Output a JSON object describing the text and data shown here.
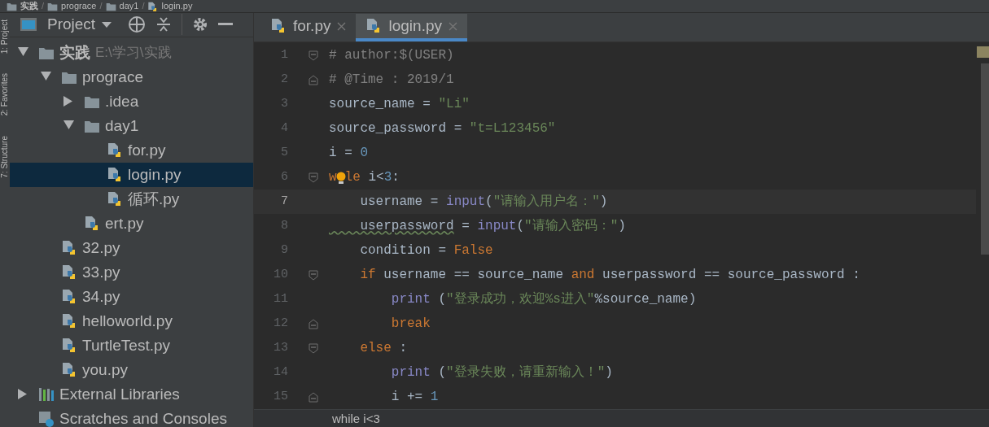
{
  "breadcrumb": {
    "separator": "/",
    "items": [
      "实践",
      "prograce",
      "day1",
      "login.py"
    ]
  },
  "side_strip": [
    "1: Project",
    "2: Favorites",
    "7: Structure"
  ],
  "project_panel": {
    "title": "Project"
  },
  "tree": [
    {
      "kind": "folder",
      "label": "实践",
      "path": "E:\\学习\\实践",
      "expanded": true,
      "selected": false,
      "children": [
        {
          "kind": "folder",
          "label": "prograce",
          "expanded": true,
          "selected": false,
          "children": [
            {
              "kind": "folder",
              "label": ".idea",
              "expanded": false,
              "selected": false
            },
            {
              "kind": "folder",
              "label": "day1",
              "expanded": true,
              "selected": false,
              "children": [
                {
                  "kind": "file",
                  "label": "for.py",
                  "selected": false
                },
                {
                  "kind": "file",
                  "label": "login.py",
                  "selected": true
                },
                {
                  "kind": "file",
                  "label": "循环.py",
                  "selected": false
                }
              ]
            },
            {
              "kind": "file",
              "label": "ert.py",
              "selected": false
            }
          ]
        },
        {
          "kind": "file",
          "label": "32.py",
          "selected": false
        },
        {
          "kind": "file",
          "label": "33.py",
          "selected": false
        },
        {
          "kind": "file",
          "label": "34.py",
          "selected": false
        },
        {
          "kind": "file",
          "label": "helloworld.py",
          "selected": false
        },
        {
          "kind": "file",
          "label": "TurtleTest.py",
          "selected": false
        },
        {
          "kind": "file",
          "label": "you.py",
          "selected": false
        }
      ]
    },
    {
      "kind": "library",
      "label": "External Libraries",
      "expanded": false,
      "selected": false
    },
    {
      "kind": "scratches",
      "label": "Scratches and Consoles",
      "selected": false
    }
  ],
  "tabs": [
    {
      "label": "for.py",
      "selected": false
    },
    {
      "label": "login.py",
      "selected": true
    }
  ],
  "code": [
    {
      "n": "1",
      "fold_open": true,
      "fold_close": false,
      "current": false,
      "lightbulb": false,
      "tokens": [
        {
          "kind": "comment",
          "t": "# author:$(USER)"
        }
      ]
    },
    {
      "n": "2",
      "fold_open": false,
      "fold_close": true,
      "current": false,
      "lightbulb": false,
      "tokens": [
        {
          "kind": "comment",
          "t": "# @Time : 2019/1"
        }
      ]
    },
    {
      "n": "3",
      "fold_open": false,
      "fold_close": false,
      "current": false,
      "lightbulb": false,
      "tokens": [
        {
          "kind": "plain",
          "t": "source_name = "
        },
        {
          "kind": "string",
          "t": "\"Li\""
        }
      ]
    },
    {
      "n": "4",
      "fold_open": false,
      "fold_close": false,
      "current": false,
      "lightbulb": false,
      "tokens": [
        {
          "kind": "plain",
          "t": "source_password = "
        },
        {
          "kind": "string",
          "t": "\"t=L123456\""
        }
      ]
    },
    {
      "n": "5",
      "fold_open": false,
      "fold_close": false,
      "current": false,
      "lightbulb": false,
      "tokens": [
        {
          "kind": "plain",
          "t": "i = "
        },
        {
          "kind": "number",
          "t": "0"
        }
      ]
    },
    {
      "n": "6",
      "fold_open": true,
      "fold_close": false,
      "current": false,
      "lightbulb": true,
      "tokens": [
        {
          "kind": "keyword",
          "t": "w"
        },
        {
          "kind": "keyword",
          "t": "le"
        },
        {
          "kind": "plain",
          "t": " i<"
        },
        {
          "kind": "number",
          "t": "3"
        },
        {
          "kind": "plain",
          "t": ":"
        }
      ]
    },
    {
      "n": "7",
      "fold_open": false,
      "fold_close": false,
      "current": true,
      "lightbulb": false,
      "tokens": [
        {
          "kind": "plain",
          "t": "    username = "
        },
        {
          "kind": "builtin",
          "t": "input"
        },
        {
          "kind": "plain",
          "t": "("
        },
        {
          "kind": "string",
          "t": "\"请输入用户名：\""
        },
        {
          "kind": "plain",
          "t": ")"
        }
      ]
    },
    {
      "n": "8",
      "fold_open": false,
      "fold_close": false,
      "current": false,
      "lightbulb": false,
      "tokens": [
        {
          "kind": "warning",
          "t": "    userpassword"
        },
        {
          "kind": "plain",
          "t": " = "
        },
        {
          "kind": "builtin",
          "t": "input"
        },
        {
          "kind": "plain",
          "t": "("
        },
        {
          "kind": "string",
          "t": "\"请输入密码：\""
        },
        {
          "kind": "plain",
          "t": ")"
        }
      ]
    },
    {
      "n": "9",
      "fold_open": false,
      "fold_close": false,
      "current": false,
      "lightbulb": false,
      "tokens": [
        {
          "kind": "plain",
          "t": "    condition = "
        },
        {
          "kind": "keyword",
          "t": "False"
        }
      ]
    },
    {
      "n": "10",
      "fold_open": true,
      "fold_close": false,
      "current": false,
      "lightbulb": false,
      "tokens": [
        {
          "kind": "keyword",
          "t": "    if"
        },
        {
          "kind": "plain",
          "t": " username == source_name "
        },
        {
          "kind": "keyword",
          "t": "and"
        },
        {
          "kind": "plain",
          "t": " userpassword == source_password :"
        }
      ]
    },
    {
      "n": "11",
      "fold_open": false,
      "fold_close": false,
      "current": false,
      "lightbulb": false,
      "tokens": [
        {
          "kind": "builtin",
          "t": "        print"
        },
        {
          "kind": "plain",
          "t": " ("
        },
        {
          "kind": "string",
          "t": "\"登录成功，欢迎%s进入\""
        },
        {
          "kind": "plain",
          "t": "%source_name)"
        }
      ]
    },
    {
      "n": "12",
      "fold_open": false,
      "fold_close": true,
      "current": false,
      "lightbulb": false,
      "tokens": [
        {
          "kind": "keyword",
          "t": "        break"
        }
      ]
    },
    {
      "n": "13",
      "fold_open": true,
      "fold_close": false,
      "current": false,
      "lightbulb": false,
      "tokens": [
        {
          "kind": "keyword",
          "t": "    else"
        },
        {
          "kind": "plain",
          "t": " :"
        }
      ]
    },
    {
      "n": "14",
      "fold_open": false,
      "fold_close": false,
      "current": false,
      "lightbulb": false,
      "tokens": [
        {
          "kind": "builtin",
          "t": "        print"
        },
        {
          "kind": "plain",
          "t": " ("
        },
        {
          "kind": "string",
          "t": "\"登录失败，请重新输入！\""
        },
        {
          "kind": "plain",
          "t": ")"
        }
      ]
    },
    {
      "n": "15",
      "fold_open": false,
      "fold_close": true,
      "current": false,
      "lightbulb": false,
      "tokens": [
        {
          "kind": "plain",
          "t": "        i += "
        },
        {
          "kind": "number",
          "t": "1"
        }
      ]
    }
  ],
  "editor_breadcrumb": "while i<3"
}
